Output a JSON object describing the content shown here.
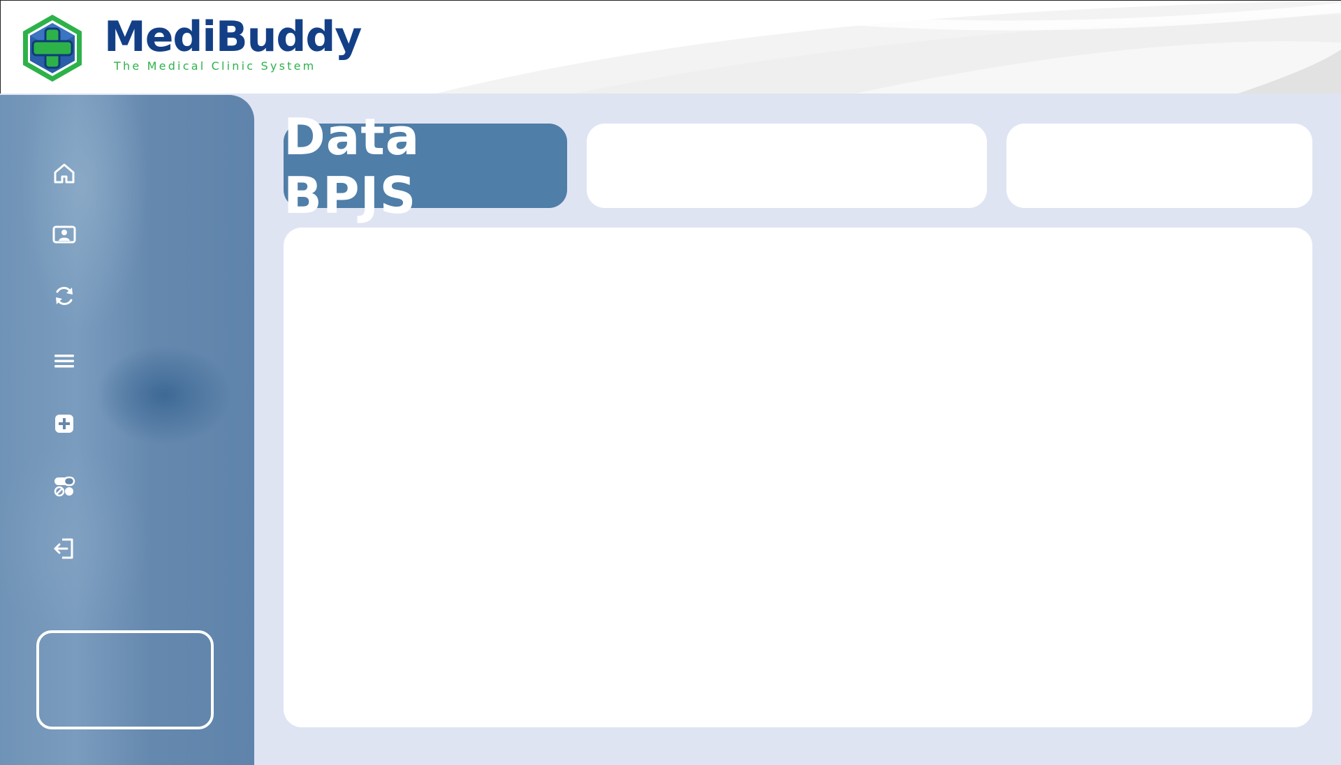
{
  "app": {
    "logo_name": "MediBuddy",
    "tagline": "The Medical Clinic System"
  },
  "sidebar": {
    "items": [
      {
        "icon": "home-icon"
      },
      {
        "icon": "patient-card-icon"
      },
      {
        "icon": "refresh-icon"
      },
      {
        "icon": "menu-icon"
      },
      {
        "icon": "medical-plus-icon"
      },
      {
        "icon": "pills-icon"
      },
      {
        "icon": "logout-icon"
      }
    ]
  },
  "main": {
    "page_title": "Data BPJS"
  },
  "colors": {
    "brand_blue": "#133f86",
    "brand_green": "#2db24a",
    "sidebar": "#6f93b6",
    "title_card": "#4f7ea8",
    "background": "#dfe4f3"
  }
}
